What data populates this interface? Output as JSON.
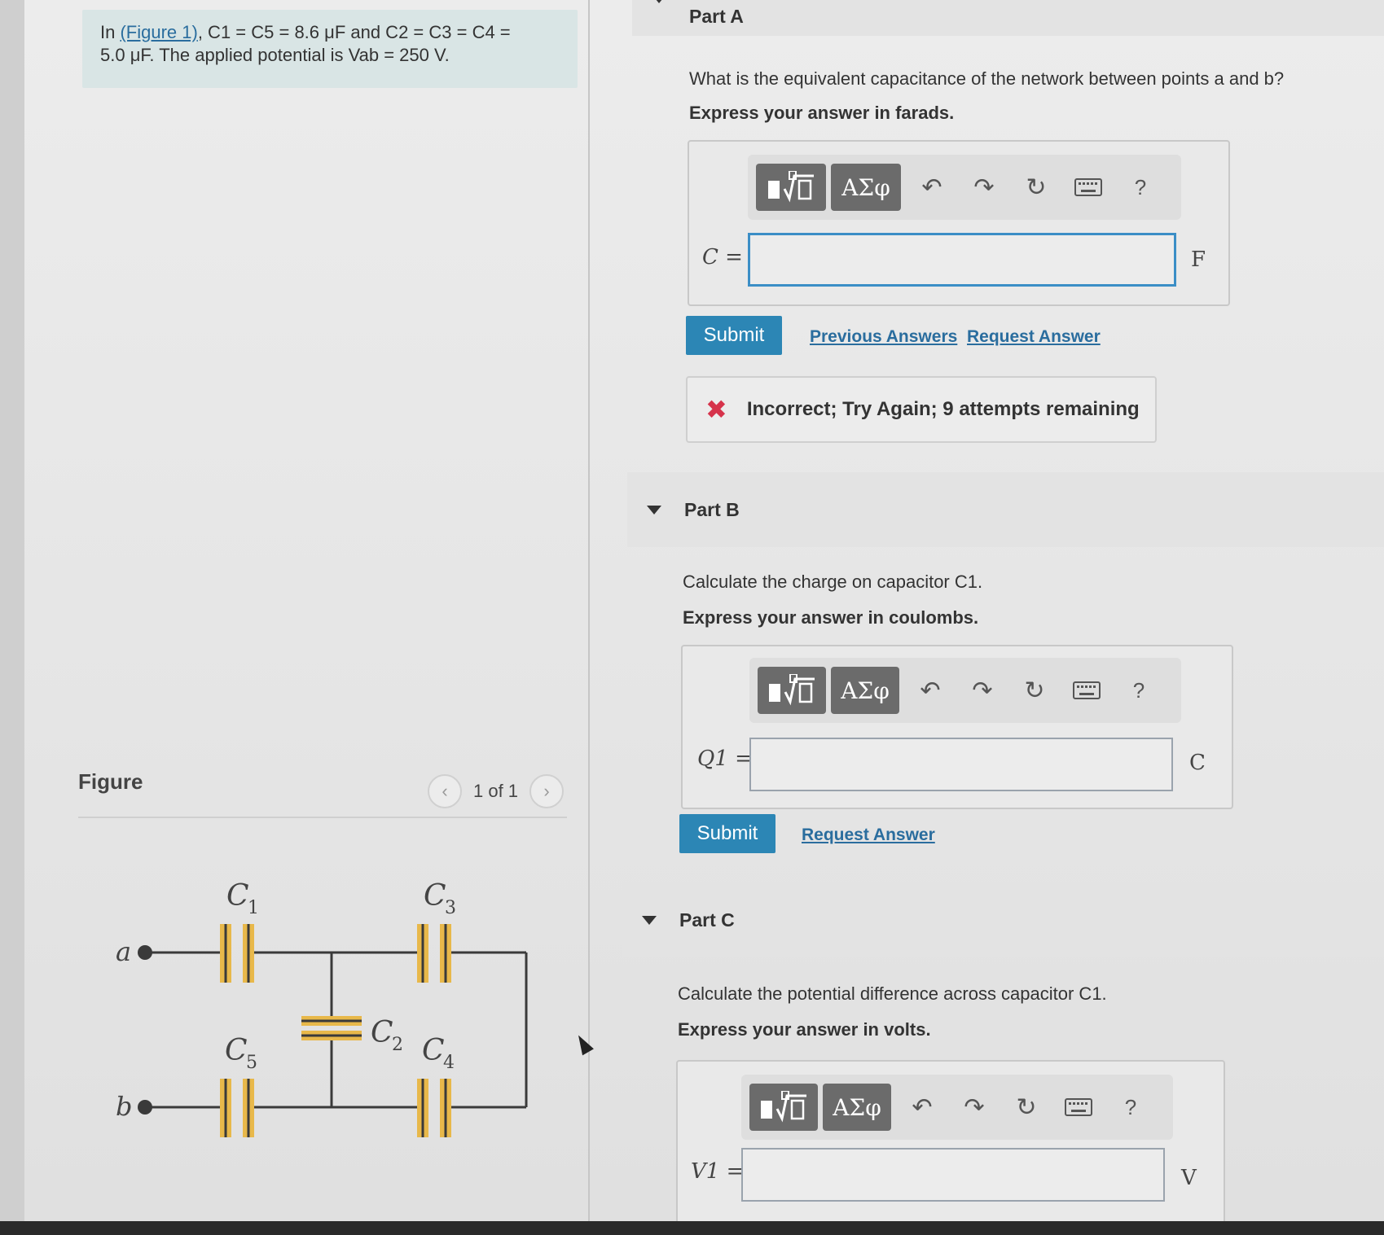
{
  "problem": {
    "prefix": "In ",
    "figure_link": "(Figure 1)",
    "line1_rest": ", C1 = C5 = 8.6 μF and C2 = C3 = C4 =",
    "line2": "5.0 μF. The applied potential is Vab = 250 V."
  },
  "figure": {
    "label": "Figure",
    "pager": "1 of 1",
    "prev_icon": "chevron-left-icon",
    "next_icon": "chevron-right-icon",
    "labels": {
      "c1": "C",
      "c1_sub": "1",
      "c2": "C",
      "c2_sub": "2",
      "c3": "C",
      "c3_sub": "3",
      "c4": "C",
      "c4_sub": "4",
      "c5": "C",
      "c5_sub": "5",
      "a": "a",
      "b": "b"
    },
    "colors": {
      "plate": "#e8b84a",
      "wire": "#3a3a3a"
    }
  },
  "partA": {
    "title": "Part A",
    "question": "What is the equivalent capacitance of the network between points a and b?",
    "express": "Express your answer in farads.",
    "var_label": "C =",
    "unit": "F",
    "input_value": "",
    "submit": "Submit",
    "link1": "Previous Answers",
    "link2": "Request Answer",
    "feedback": "Incorrect; Try Again; 9 attempts remaining"
  },
  "partB": {
    "title": "Part B",
    "question": "Calculate the charge on capacitor C1.",
    "express": "Express your answer in coulombs.",
    "var_label": "Q1 =",
    "unit": "C",
    "input_value": "",
    "submit": "Submit",
    "link1": "Request Answer"
  },
  "partC": {
    "title": "Part C",
    "question": "Calculate the potential difference across capacitor C1.",
    "express": "Express your answer in volts.",
    "var_label": "V1 =",
    "unit": "V",
    "input_value": ""
  },
  "toolbar": {
    "templates_icon": "templates-icon",
    "symbols_label": "ΑΣφ",
    "undo_icon": "undo-icon",
    "redo_icon": "redo-icon",
    "reset_icon": "reset-icon",
    "keyboard_icon": "keyboard-icon",
    "help_label": "?"
  },
  "colors": {
    "accent": "#2c86b5",
    "link": "#2a6d9e",
    "error": "#d6334b",
    "problem_bg": "#d9e5e5"
  }
}
